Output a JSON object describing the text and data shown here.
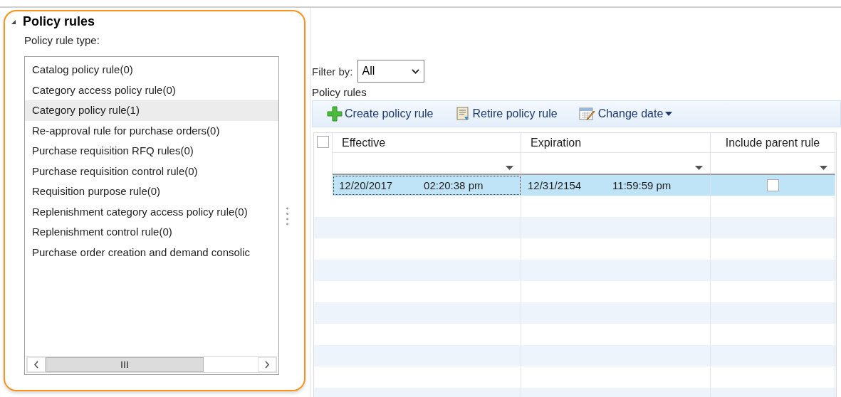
{
  "section": {
    "title": "Policy rules",
    "expanded": true,
    "type_label": "Policy rule type:",
    "rule_types": [
      {
        "label": "Catalog policy rule(0)",
        "selected": false
      },
      {
        "label": "Category access policy rule(0)",
        "selected": false
      },
      {
        "label": "Category policy rule(1)",
        "selected": true
      },
      {
        "label": "Re-approval rule for purchase orders(0)",
        "selected": false
      },
      {
        "label": "Purchase requisition RFQ rules(0)",
        "selected": false
      },
      {
        "label": "Purchase requisition control rule(0)",
        "selected": false
      },
      {
        "label": "Requisition purpose rule(0)",
        "selected": false
      },
      {
        "label": "Replenishment category access policy rule(0)",
        "selected": false
      },
      {
        "label": "Replenishment control rule(0)",
        "selected": false
      },
      {
        "label": "Purchase order creation and demand consolic",
        "selected": false
      }
    ]
  },
  "filter": {
    "label": "Filter by:",
    "value": "All"
  },
  "grid": {
    "title": "Policy rules",
    "toolbar": [
      {
        "kind": "create",
        "label": "Create policy rule"
      },
      {
        "kind": "retire",
        "label": "Retire policy rule"
      },
      {
        "kind": "date",
        "label": "Change date",
        "menu": true
      }
    ],
    "select_all": {
      "checked": false
    },
    "columns": [
      "Effective",
      "Expiration",
      "Include parent rule"
    ],
    "rows": [
      {
        "selected": true,
        "effective_date": "12/20/2017",
        "effective_time": "02:20:38 pm",
        "expiration_date": "12/31/2154",
        "expiration_time": "11:59:59 pm",
        "include_parent_rule": false
      }
    ]
  }
}
